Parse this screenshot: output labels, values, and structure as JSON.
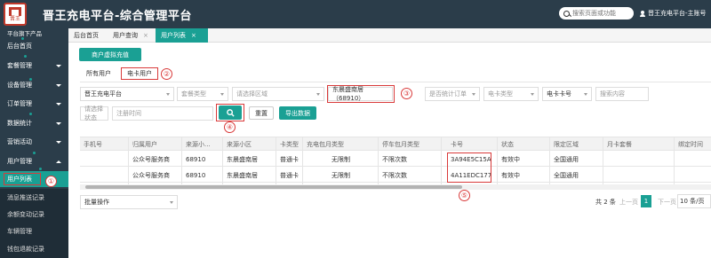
{
  "header": {
    "logo_text": "晋王",
    "title": "晋王充电平台-综合管理平台",
    "search_placeholder": "搜索页面或功能",
    "user_label": "晋王充电平台-主账号"
  },
  "sidebar": {
    "top_label": "平台旗下产品",
    "items": [
      {
        "label": "后台首页"
      },
      {
        "label": "套餐管理"
      },
      {
        "label": "设备管理"
      },
      {
        "label": "订单管理"
      },
      {
        "label": "数据统计"
      },
      {
        "label": "营销活动"
      },
      {
        "label": "用户管理"
      }
    ],
    "sub_items": [
      {
        "label": "用户列表"
      },
      {
        "label": "消息推送记录"
      },
      {
        "label": "余额变动记录"
      },
      {
        "label": "车辆管理"
      },
      {
        "label": "钱包退款记录"
      }
    ]
  },
  "tabs": [
    {
      "label": "后台首页"
    },
    {
      "label": "用户查询"
    },
    {
      "label": "用户列表"
    }
  ],
  "toolbar": {
    "recharge_button": "商户虚拟充值"
  },
  "subtabs": {
    "all": "所有用户",
    "card": "电卡用户"
  },
  "annotations": {
    "n1": "①",
    "n2": "②",
    "n3": "③",
    "n4": "④",
    "n5": "⑤"
  },
  "filters": {
    "platform": "晋王充电平台",
    "package_type": "套餐类型",
    "region": "请选择区域",
    "community": "东晨盛南居（68910）",
    "has_order": "是否统计订单",
    "card_type": "电卡类型",
    "card_no": "电卡卡号",
    "search_content": "搜索内容",
    "status": "请选择状态",
    "register_time": "注册时间",
    "reset_button": "重置",
    "export_button": "导出数据"
  },
  "table": {
    "headers": [
      "手机号",
      "归属用户",
      "来源小...",
      "来源小区",
      "卡类型",
      "充电包月类型",
      "停车包月类型",
      "卡号",
      "状态",
      "限定区域",
      "月卡套餐",
      "绑定时间"
    ],
    "rows": [
      [
        "",
        "公众号服务商",
        "68910",
        "东晨盛南居",
        "普通卡",
        "无限制",
        "不限次数",
        "3A94E5C15A",
        "有效中",
        "全国通用",
        "",
        ""
      ],
      [
        "",
        "公众号服务商",
        "68910",
        "东晨盛南居",
        "普通卡",
        "无限制",
        "不限次数",
        "4A11EDC177",
        "有效中",
        "全国通用",
        "",
        ""
      ]
    ]
  },
  "footer": {
    "batch_action": "批量操作",
    "total": "共 2 条",
    "prev": "上一页",
    "page": "1",
    "next": "下一页",
    "page_size": "10 条/页"
  },
  "colors": {
    "accent": "#1aa094",
    "dark": "#2b3d4a",
    "annotation": "#d93a3a"
  }
}
